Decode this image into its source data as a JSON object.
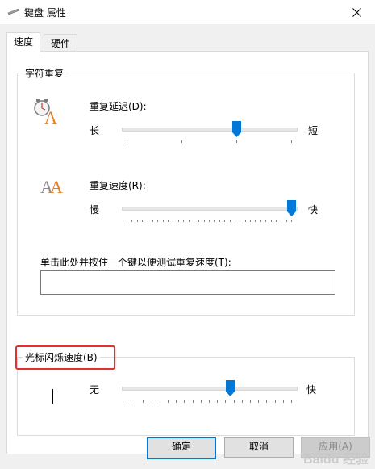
{
  "window": {
    "title": "键盘 属性"
  },
  "tabs": [
    {
      "label": "速度",
      "active": true
    },
    {
      "label": "硬件",
      "active": false
    }
  ],
  "char_repeat": {
    "title": "字符重复",
    "delay": {
      "label": "重复延迟(D):",
      "left": "长",
      "right": "短",
      "value_fraction": 0.67,
      "tick_count": 4
    },
    "rate": {
      "label": "重复速度(R):",
      "left": "慢",
      "right": "快",
      "value_fraction": 1.0,
      "tick_count": 33
    },
    "test_label": "单击此处并按住一个键以便测试重复速度(T):",
    "test_value": ""
  },
  "cursor_blink": {
    "title": "光标闪烁速度(B)",
    "left": "无",
    "right": "快",
    "value_fraction": 0.63,
    "tick_count": 21
  },
  "buttons": {
    "ok": "确定",
    "cancel": "取消",
    "apply": "应用(A)"
  },
  "watermark": "Baidu 经验",
  "colors": {
    "accent": "#0078d7",
    "highlight": "#e0302f"
  }
}
